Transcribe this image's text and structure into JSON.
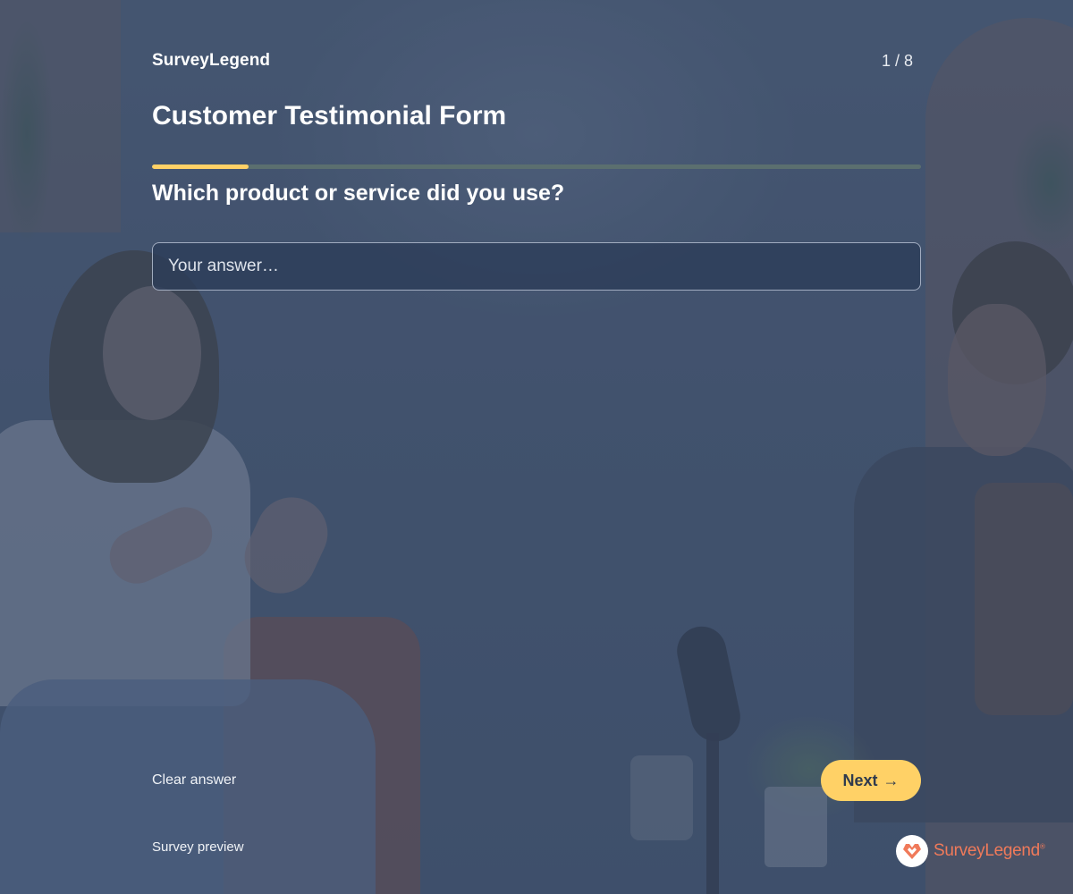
{
  "header": {
    "brand": "SurveyLegend",
    "page_counter": "1 / 8"
  },
  "form": {
    "title": "Customer Testimonial Form",
    "progress_fraction": 0.125
  },
  "question": {
    "text": "Which product or service did you use?",
    "answer_value": "",
    "answer_placeholder": "Your answer…"
  },
  "footer": {
    "clear_label": "Clear answer",
    "next_label": "Next",
    "next_arrow": "→",
    "preview_label": "Survey preview"
  },
  "logo": {
    "text": "SurveyLegend",
    "reg_mark": "®",
    "icon": "heart-diamond-icon"
  },
  "colors": {
    "accent": "#ffd166",
    "logo": "#f07a5a",
    "overlay": "#44546c"
  }
}
